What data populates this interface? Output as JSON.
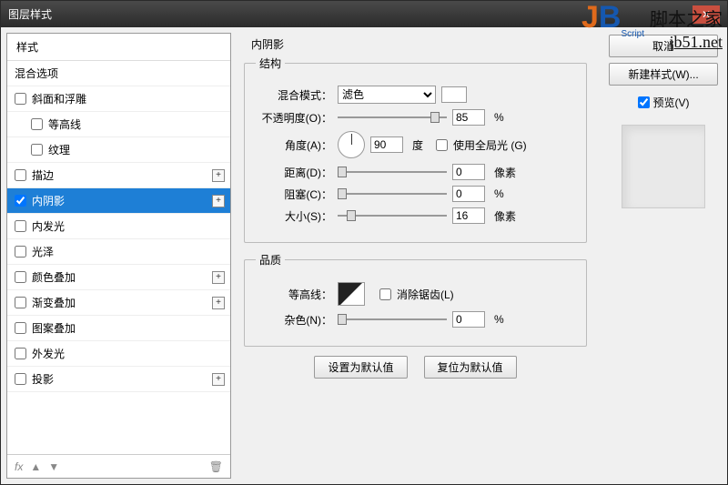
{
  "window": {
    "title": "图层样式"
  },
  "sidebar": {
    "header": "样式",
    "blending": "混合选项",
    "items": [
      {
        "label": "斜面和浮雕",
        "checked": false,
        "has_plus": false
      },
      {
        "label": "等高线",
        "checked": false,
        "indent": true
      },
      {
        "label": "纹理",
        "checked": false,
        "indent": true
      },
      {
        "label": "描边",
        "checked": false,
        "has_plus": true
      },
      {
        "label": "内阴影",
        "checked": true,
        "has_plus": true,
        "selected": true
      },
      {
        "label": "内发光",
        "checked": false
      },
      {
        "label": "光泽",
        "checked": false
      },
      {
        "label": "颜色叠加",
        "checked": false,
        "has_plus": true
      },
      {
        "label": "渐变叠加",
        "checked": false,
        "has_plus": true
      },
      {
        "label": "图案叠加",
        "checked": false
      },
      {
        "label": "外发光",
        "checked": false
      },
      {
        "label": "投影",
        "checked": false,
        "has_plus": true
      }
    ],
    "footer": {
      "fx": "fx"
    }
  },
  "panel": {
    "title": "内阴影",
    "group_structure": "结构",
    "blend_mode_label": "混合模式：",
    "blend_mode_value": "滤色",
    "opacity_label": "不透明度(O)：",
    "opacity_value": "85",
    "opacity_unit": "%",
    "angle_label": "角度(A)：",
    "angle_value": "90",
    "angle_unit": "度",
    "global_light_label": "使用全局光 (G)",
    "global_light_checked": false,
    "distance_label": "距离(D)：",
    "distance_value": "0",
    "distance_unit": "像素",
    "choke_label": "阻塞(C)：",
    "choke_value": "0",
    "choke_unit": "%",
    "size_label": "大小(S)：",
    "size_value": "16",
    "size_unit": "像素",
    "group_quality": "品质",
    "contour_label": "等高线：",
    "antialias_label": "消除锯齿(L)",
    "antialias_checked": false,
    "noise_label": "杂色(N)：",
    "noise_value": "0",
    "noise_unit": "%",
    "btn_default": "设置为默认值",
    "btn_reset": "复位为默认值"
  },
  "right": {
    "cancel": "取消",
    "new_style": "新建样式(W)...",
    "preview_label": "预览(V)",
    "preview_checked": true
  },
  "watermark": {
    "script": "Script",
    "cn": "脚本之家",
    "url": "jb51.net"
  }
}
